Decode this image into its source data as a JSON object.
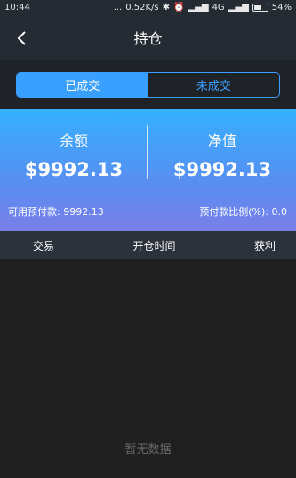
{
  "status_bar": {
    "time": "10:44",
    "dots": "...",
    "speed": "0.52K/s",
    "network": "4G",
    "battery": "54%"
  },
  "nav": {
    "title": "持仓",
    "back_icon": "chevron-left-icon"
  },
  "tabs": [
    {
      "label": "已成交",
      "active": true
    },
    {
      "label": "未成交",
      "active": false
    }
  ],
  "balance": {
    "left_label": "余额",
    "left_value": "$9992.13",
    "right_label": "净值",
    "right_value": "$9992.13",
    "available": "可用预付款: 9992.13",
    "ratio": "预付款比例(%): 0.0"
  },
  "table": {
    "columns": [
      "交易",
      "开仓时间",
      "获利"
    ]
  },
  "empty_text": "暂无数据",
  "colors": {
    "accent": "#3aa0ff",
    "header_bg": "#252b33",
    "page_bg": "#202020"
  }
}
